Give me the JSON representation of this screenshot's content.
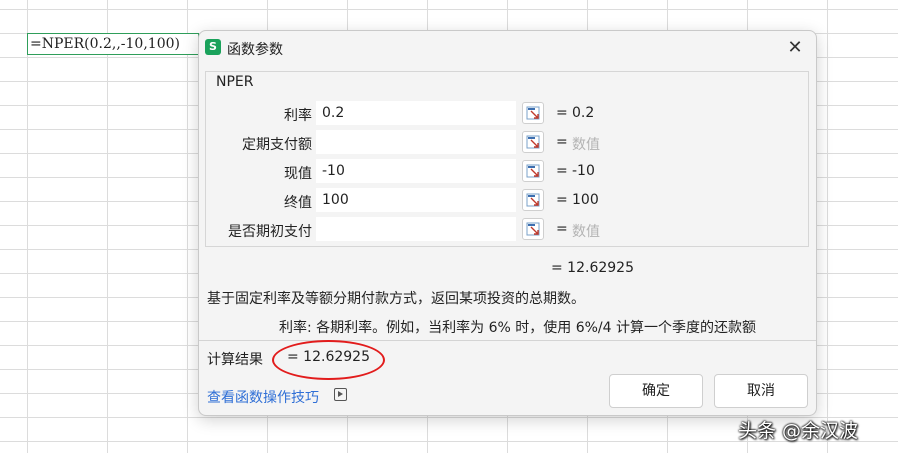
{
  "sheet": {
    "cell_formula": "=NPER(0.2,,-10,100)"
  },
  "dialog": {
    "app_icon_letter": "S",
    "title": "函数参数",
    "close_glyph": "✕",
    "function_name": "NPER",
    "args": [
      {
        "label": "利率",
        "value": "0.2",
        "eq": "=",
        "result": "0.2",
        "placeholder": false
      },
      {
        "label": "定期支付额",
        "value": "",
        "eq": "=",
        "result": "数值",
        "placeholder": true
      },
      {
        "label": "现值",
        "value": "-10",
        "eq": "=",
        "result": "-10",
        "placeholder": false
      },
      {
        "label": "终值",
        "value": "100",
        "eq": "=",
        "result": "100",
        "placeholder": false
      },
      {
        "label": "是否期初支付",
        "value": "",
        "eq": "=",
        "result": "数值",
        "placeholder": true
      }
    ],
    "formula_result": "= 12.62925",
    "description": "基于固定利率及等额分期付款方式，返回某项投资的总期数。",
    "arg_description": "利率:  各期利率。例如，当利率为 6% 时，使用 6%/4 计算一个季度的还款额",
    "calc_label": "计算结果",
    "calc_value": "= 12.62925",
    "help_link": "查看函数操作技巧",
    "ok_label": "确定",
    "cancel_label": "取消"
  },
  "watermark": "头条 @余汉波",
  "colors": {
    "accent_green": "#1aa25b",
    "link_blue": "#2f6fd6",
    "annotation_red": "#e21c1c"
  }
}
